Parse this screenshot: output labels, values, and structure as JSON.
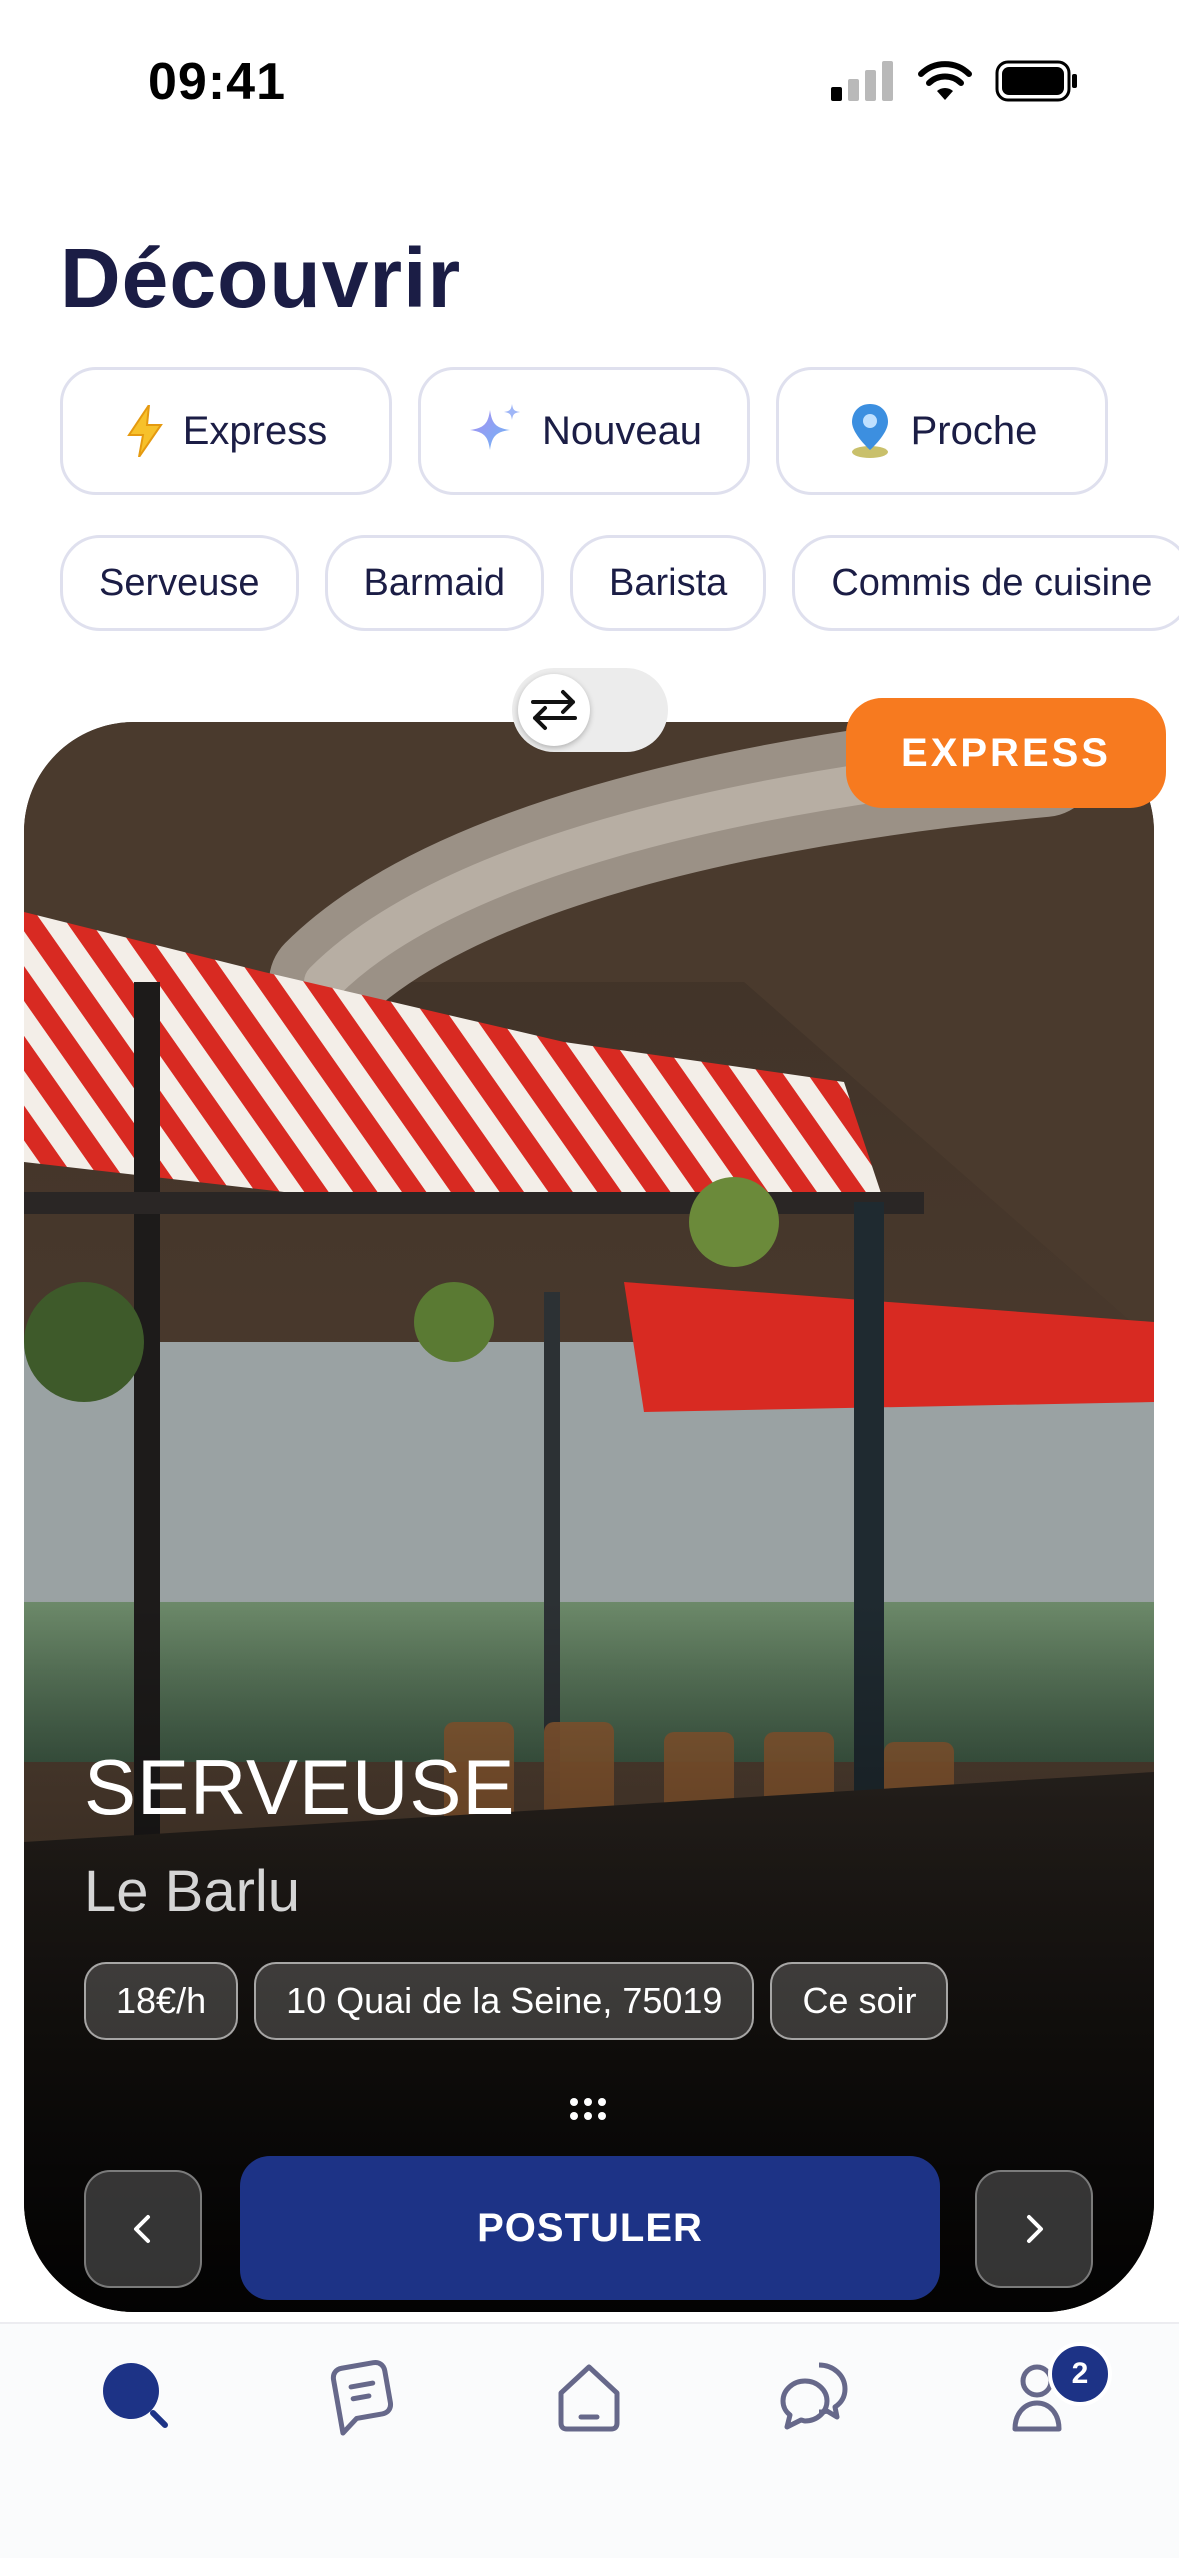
{
  "status_bar": {
    "time": "09:41"
  },
  "page": {
    "title": "Découvrir"
  },
  "quick_filters": [
    {
      "label": "Express",
      "icon": "lightning-icon"
    },
    {
      "label": "Nouveau",
      "icon": "sparkle-icon"
    },
    {
      "label": "Proche",
      "icon": "location-pin-icon"
    }
  ],
  "categories": [
    "Serveuse",
    "Barmaid",
    "Barista",
    "Commis de cuisine"
  ],
  "card": {
    "badge": "EXPRESS",
    "job_title": "SERVEUSE",
    "venue": "Le Barlu",
    "tags": [
      "18€/h",
      "10 Quai de la Seine, 75019",
      "Ce soir"
    ],
    "apply_label": "POSTULER"
  },
  "tabbar": {
    "items": [
      "search-icon",
      "jobs-icon",
      "home-icon",
      "messages-icon",
      "profile-icon"
    ],
    "profile_badge": "2"
  },
  "colors": {
    "accent": "#1d3386",
    "express": "#f77a1f",
    "title": "#1b1d45"
  }
}
